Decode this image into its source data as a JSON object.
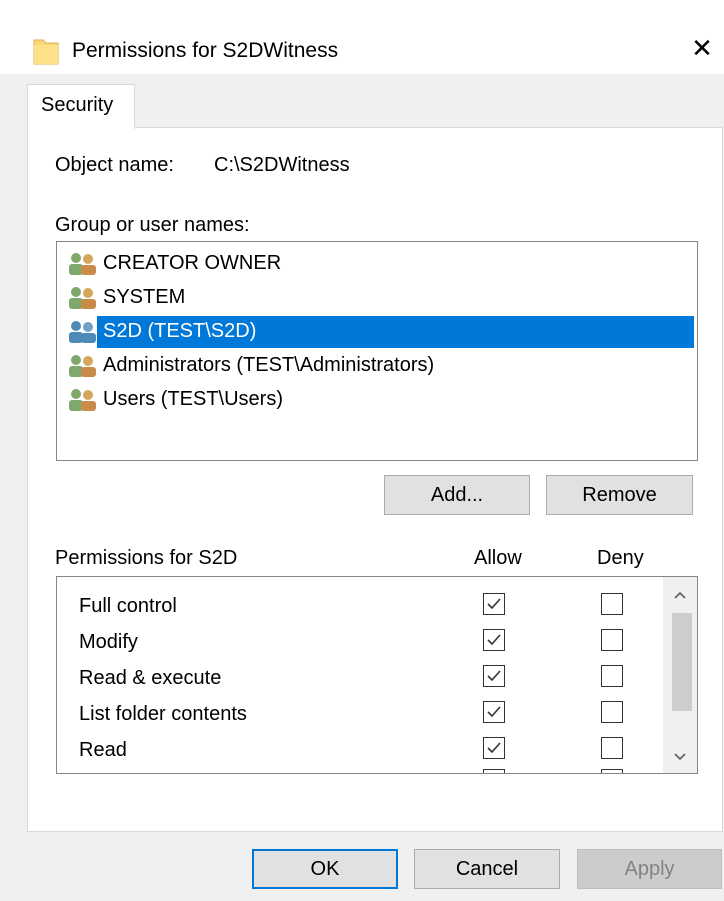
{
  "window": {
    "title": "Permissions for S2DWitness",
    "close_glyph": "✕",
    "folder_icon": "folder-icon"
  },
  "tabs": [
    {
      "label": "Security",
      "active": true
    }
  ],
  "object": {
    "label": "Object name:",
    "value": "C:\\S2DWitness"
  },
  "group_list": {
    "label": "Group or user names:",
    "items": [
      {
        "name": "CREATOR OWNER",
        "selected": false
      },
      {
        "name": "SYSTEM",
        "selected": false
      },
      {
        "name": "S2D (TEST\\S2D)",
        "selected": true
      },
      {
        "name": "Administrators (TEST\\Administrators)",
        "selected": false
      },
      {
        "name": "Users (TEST\\Users)",
        "selected": false
      }
    ]
  },
  "group_buttons": {
    "add_label": "Add...",
    "remove_label": "Remove"
  },
  "permissions": {
    "label": "Permissions for S2D",
    "allow_label": "Allow",
    "deny_label": "Deny",
    "rows": [
      {
        "name": "Full control",
        "allow": true,
        "deny": false
      },
      {
        "name": "Modify",
        "allow": true,
        "deny": false
      },
      {
        "name": "Read & execute",
        "allow": true,
        "deny": false
      },
      {
        "name": "List folder contents",
        "allow": true,
        "deny": false
      },
      {
        "name": "Read",
        "allow": true,
        "deny": false
      },
      {
        "name": "",
        "allow": true,
        "deny": false
      }
    ]
  },
  "footer": {
    "ok_label": "OK",
    "cancel_label": "Cancel",
    "apply_label": "Apply",
    "apply_enabled": false
  },
  "colors": {
    "selection": "#0078d7",
    "dialog_bg": "#f0f0f0",
    "accent": "#0078d7"
  }
}
